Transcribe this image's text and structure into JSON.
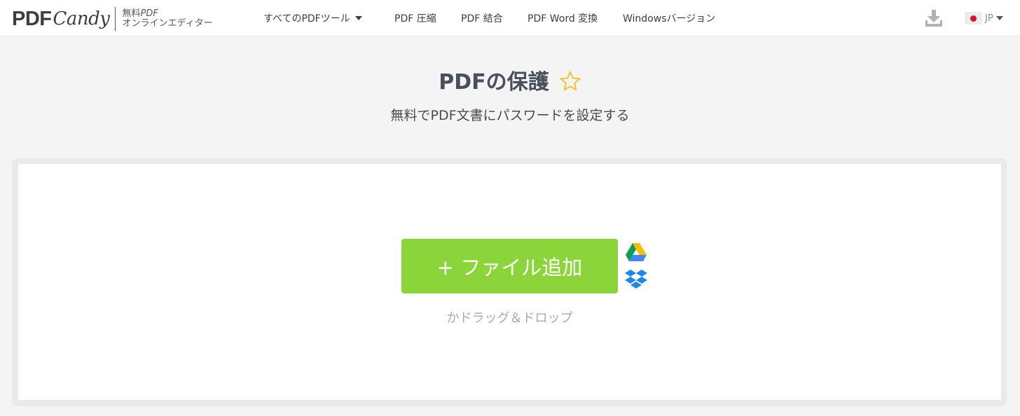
{
  "header": {
    "logo": {
      "brand_bold": "PDF",
      "brand_script": "Candy",
      "tagline_line1_prefix": "無料",
      "tagline_line1_suffix": "PDF",
      "tagline_line2": "オンラインエディター"
    },
    "nav": [
      {
        "label": "すべてのPDFツール",
        "has_dropdown": true
      },
      {
        "label": "PDF 圧縮"
      },
      {
        "label": "PDF 結合"
      },
      {
        "label": "PDF Word 変換"
      },
      {
        "label": "Windowsバージョン"
      }
    ],
    "download_icon": "download-icon",
    "language": {
      "code": "JP",
      "flag": "japan-flag-icon"
    }
  },
  "main": {
    "title": "PDFの保護",
    "favorite_icon": "star-outline-icon",
    "subtitle": "無料でPDF文書にパスワードを設定する",
    "upload": {
      "button_label": "+ ファイル追加",
      "drag_hint": "かドラッグ＆ドロップ",
      "cloud_sources": [
        "google-drive-icon",
        "dropbox-icon"
      ]
    }
  },
  "colors": {
    "accent_green": "#8bd43a",
    "title_text": "#4a4f5c",
    "star_yellow": "#f5c332",
    "dropbox_blue": "#1e88e5",
    "flag_red": "#d21034"
  }
}
